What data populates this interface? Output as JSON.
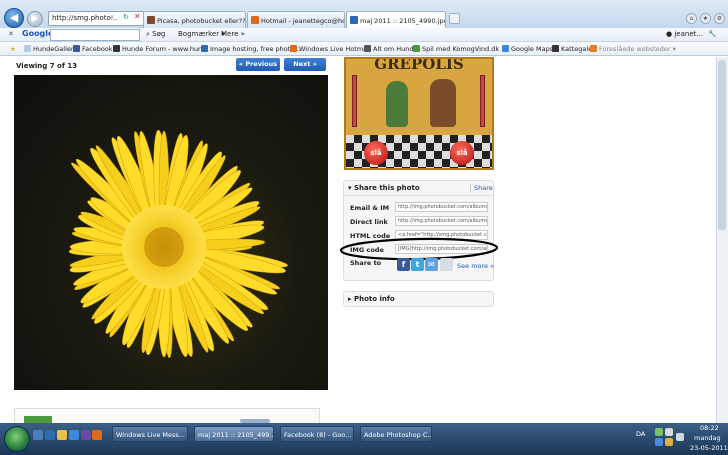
{
  "browser": {
    "address": "http://smg.photo...",
    "tabs": [
      {
        "label": "Picasa, photobucket eller??? Hj..."
      },
      {
        "label": "Hotmail - jeanettegco@hotm..."
      },
      {
        "label": "maj 2011 :: 2105_4990.jpg i..."
      }
    ],
    "user_label": "jeanet..."
  },
  "google_toolbar": {
    "logo": "Google",
    "items": [
      "Søg",
      "Bogmærker",
      "Mere"
    ]
  },
  "favorites": [
    "HundeGalleri",
    "Facebook",
    "Hunde Forum - www.hun...",
    "Image hosting, free photo...",
    "Windows Live Hotmail",
    "Alt om Hund",
    "Spil med KomogVind.dk",
    "Google Maps",
    "Kattegale",
    "Foreslåede websteder"
  ],
  "page": {
    "viewing_label": "Viewing 7 of 13",
    "prev_label": "« Previous",
    "next_label": "Next »",
    "ad_title": "GREPOLIS",
    "ad_button_left": "slå",
    "ad_button_right": "slå",
    "share_panel": {
      "title": "Share this photo",
      "share_link": "Share",
      "rows": [
        {
          "label": "Email & IM",
          "value": "http://img.photobucket.com/albums/v18"
        },
        {
          "label": "Direct link",
          "value": "http://img.photobucket.com/albums/v18"
        },
        {
          "label": "HTML code",
          "value": "<a href=\"http://smg.photobucket.com/alb"
        },
        {
          "label": "IMG code",
          "value": "[IMG]http://img.photobucket.com/album/"
        }
      ],
      "share_to_label": "Share to",
      "see_more": "See more »"
    },
    "info_panel_title": "Photo info"
  },
  "taskbar": {
    "tasks": [
      "Windows Live Mess...",
      "maj 2011 :: 2105_499...",
      "Facebook (8) - Goo...",
      "Adobe Photoshop C..."
    ],
    "language": "DA",
    "time": "08:22",
    "day": "mandag",
    "date": "23-05-2011"
  }
}
